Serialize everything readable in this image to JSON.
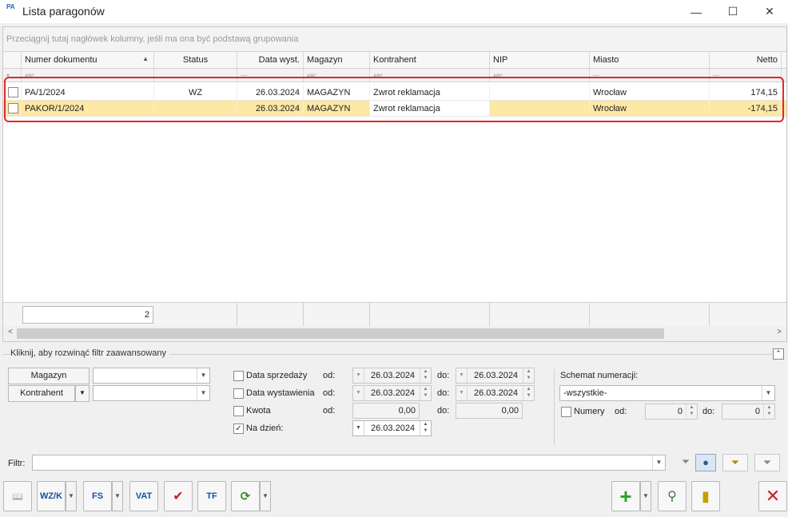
{
  "window": {
    "app_icon": "PA",
    "title": "Lista paragonów",
    "minimize": "—",
    "maximize": "☐",
    "close": "✕"
  },
  "grid": {
    "group_hint": "Przeciągnij tutaj nagłówek kolumny, jeśli ma ona być podstawą grupowania",
    "columns": {
      "numer": "Numer dokumentu",
      "status": "Status",
      "data": "Data wyst.",
      "magazyn": "Magazyn",
      "kontrahent": "Kontrahent",
      "nip": "NIP",
      "miasto": "Miasto",
      "netto": "Netto"
    },
    "sort_indicator": "▲",
    "filter_glyphs": {
      "text": "ᴀʙc",
      "date": "—",
      "num": "—"
    },
    "rows": [
      {
        "numer": "PA/1/2024",
        "status": "WZ",
        "data": "26.03.2024",
        "magazyn": "MAGAZYN",
        "kontrahent": "Zwrot reklamacja",
        "nip": "",
        "miasto": "Wrocław",
        "netto": "174,15"
      },
      {
        "numer": "PAKOR/1/2024",
        "status": "",
        "data": "26.03.2024",
        "magazyn": "MAGAZYN",
        "kontrahent": "Zwrot reklamacja",
        "nip": "",
        "miasto": "Wrocław",
        "netto": "-174,15"
      }
    ],
    "count": "2"
  },
  "advanced_filter": {
    "legend": "Kliknij, aby rozwinąć filtr zaawansowany",
    "collapse_icon": "⌃",
    "magazyn_label": "Magazyn",
    "kontrahent_label": "Kontrahent",
    "magazyn_value": "",
    "kontrahent_value": "",
    "data_sprzedazy": {
      "label": "Data sprzedaży",
      "checked": false,
      "od": "26.03.2024",
      "do": "26.03.2024"
    },
    "data_wystawienia": {
      "label": "Data wystawienia",
      "checked": false,
      "od": "26.03.2024",
      "do": "26.03.2024"
    },
    "kwota": {
      "label": "Kwota",
      "checked": false,
      "od": "0,00",
      "do": "0,00"
    },
    "na_dzien": {
      "label": "Na dzień:",
      "checked": true,
      "value": "26.03.2024"
    },
    "od_label": "od:",
    "do_label": "do:",
    "schemat_label": "Schemat numeracji:",
    "schemat_value": "-wszystkie-",
    "numery": {
      "label": "Numery",
      "checked": false,
      "od": "0",
      "do": "0"
    }
  },
  "filter_bar": {
    "label": "Filtr:",
    "value": ""
  },
  "toolbar": {
    "btn_book": "book-icon",
    "btn_wzk": "WZ/K",
    "btn_fs": "FS",
    "btn_vat": "VAT",
    "btn_check": "✔",
    "btn_tf": "TF",
    "btn_add": "+",
    "btn_close": "✕"
  }
}
